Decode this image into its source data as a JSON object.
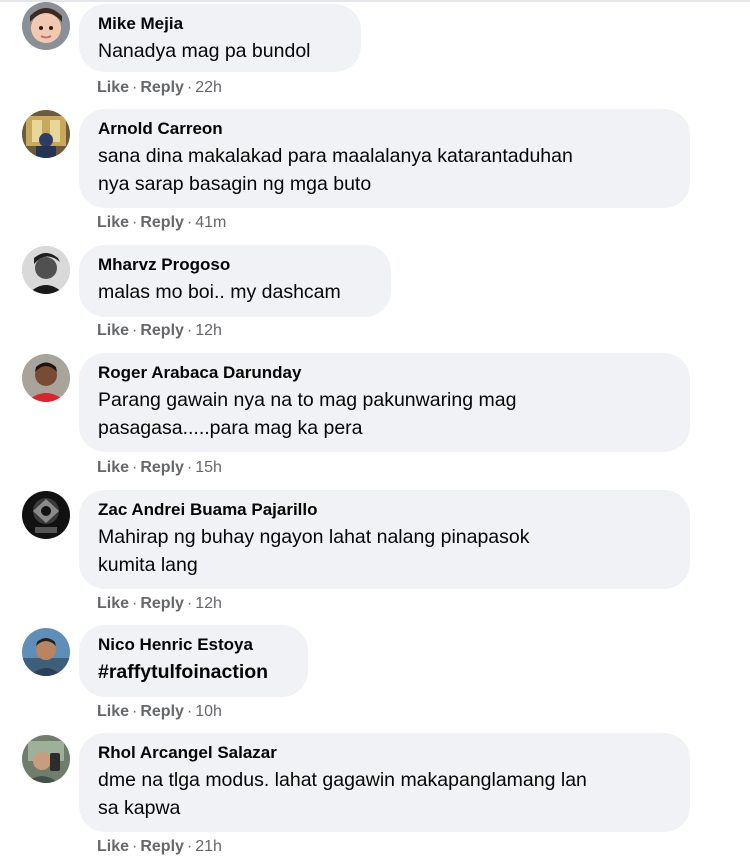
{
  "actions": {
    "like_label": "Like",
    "reply_label": "Reply",
    "separator": "·"
  },
  "comments": [
    {
      "author": "Mike Mejia",
      "lines": [
        "Nanadya mag pa bundol"
      ],
      "time": "22h",
      "avatar_icon": "child-photo-avatar"
    },
    {
      "author": "Arnold Carreon",
      "lines": [
        "sana dina makalakad para maalalanya katarantaduhan",
        "nya sarap basagin ng mga buto"
      ],
      "time": "41m",
      "avatar_icon": "interior-photo-avatar"
    },
    {
      "author": "Mharvz Progoso",
      "lines": [
        "malas mo boi.. my dashcam"
      ],
      "time": "12h",
      "avatar_icon": "bw-portrait-avatar"
    },
    {
      "author": "Roger Arabaca Darunday",
      "lines": [
        "Parang gawain nya na to mag pakunwaring mag",
        "pasagasa.....para mag ka pera"
      ],
      "time": "15h",
      "avatar_icon": "man-red-shirt-avatar"
    },
    {
      "author": "Zac Andrei Buama Pajarillo",
      "lines": [
        "Mahirap ng buhay ngayon lahat nalang pinapasok",
        "kumita lang"
      ],
      "time": "12h",
      "avatar_icon": "emblem-logo-avatar"
    },
    {
      "author": "Nico Henric Estoya",
      "lines": [
        "#raffytulfoinaction"
      ],
      "time": "10h",
      "avatar_icon": "man-outdoor-avatar",
      "bold_text": true
    },
    {
      "author": "Rhol Arcangel Salazar",
      "lines": [
        "dme na tlga modus. lahat gagawin makapanglamang lan",
        "sa kapwa"
      ],
      "time": "21h",
      "avatar_icon": "selfie-photo-avatar"
    }
  ]
}
